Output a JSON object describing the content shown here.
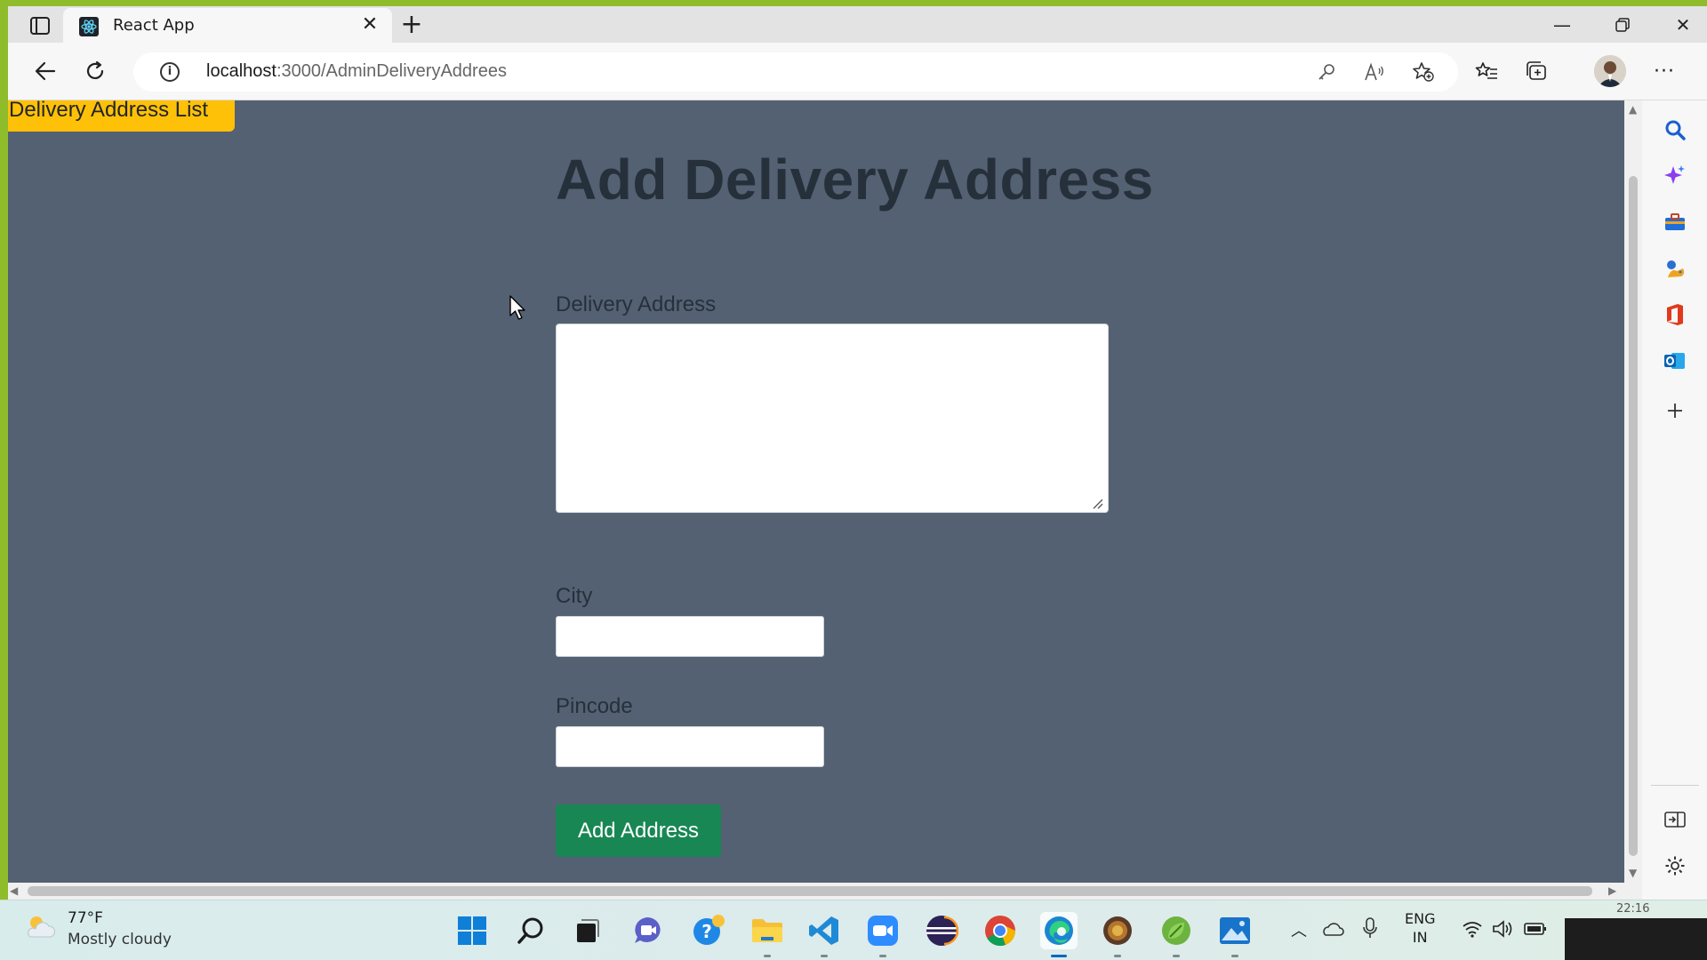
{
  "browser": {
    "tab_title": "React App",
    "url_host": "localhost",
    "url_path": ":3000/AdminDeliveryAddrees"
  },
  "page": {
    "list_button": "Delivery Address List",
    "title": "Add Delivery Address",
    "address_label": "Delivery Address",
    "address_value": "",
    "city_label": "City",
    "city_value": "",
    "pincode_label": "Pincode",
    "pincode_value": "",
    "submit_label": "Add Address"
  },
  "colors": {
    "page_bg": "#546172",
    "list_button": "#ffc107",
    "submit_button": "#198754"
  },
  "sidebar_icons": [
    "search-icon",
    "copilot-icon",
    "tools-icon",
    "games-icon",
    "office-icon",
    "outlook-icon",
    "add-icon",
    "split-screen-icon",
    "settings-icon"
  ],
  "taskbar": {
    "weather_temp": "77°F",
    "weather_desc": "Mostly cloudy",
    "lang_line1": "ENG",
    "lang_line2": "IN",
    "clock_peek": "22:16",
    "apps": [
      "start-icon",
      "search-icon",
      "task-view-icon",
      "teams-icon",
      "help-icon",
      "file-explorer-icon",
      "vscode-icon",
      "zoom-icon",
      "eclipse-icon",
      "chrome-icon",
      "edge-icon",
      "app-icon",
      "spring-icon",
      "photos-icon"
    ]
  }
}
